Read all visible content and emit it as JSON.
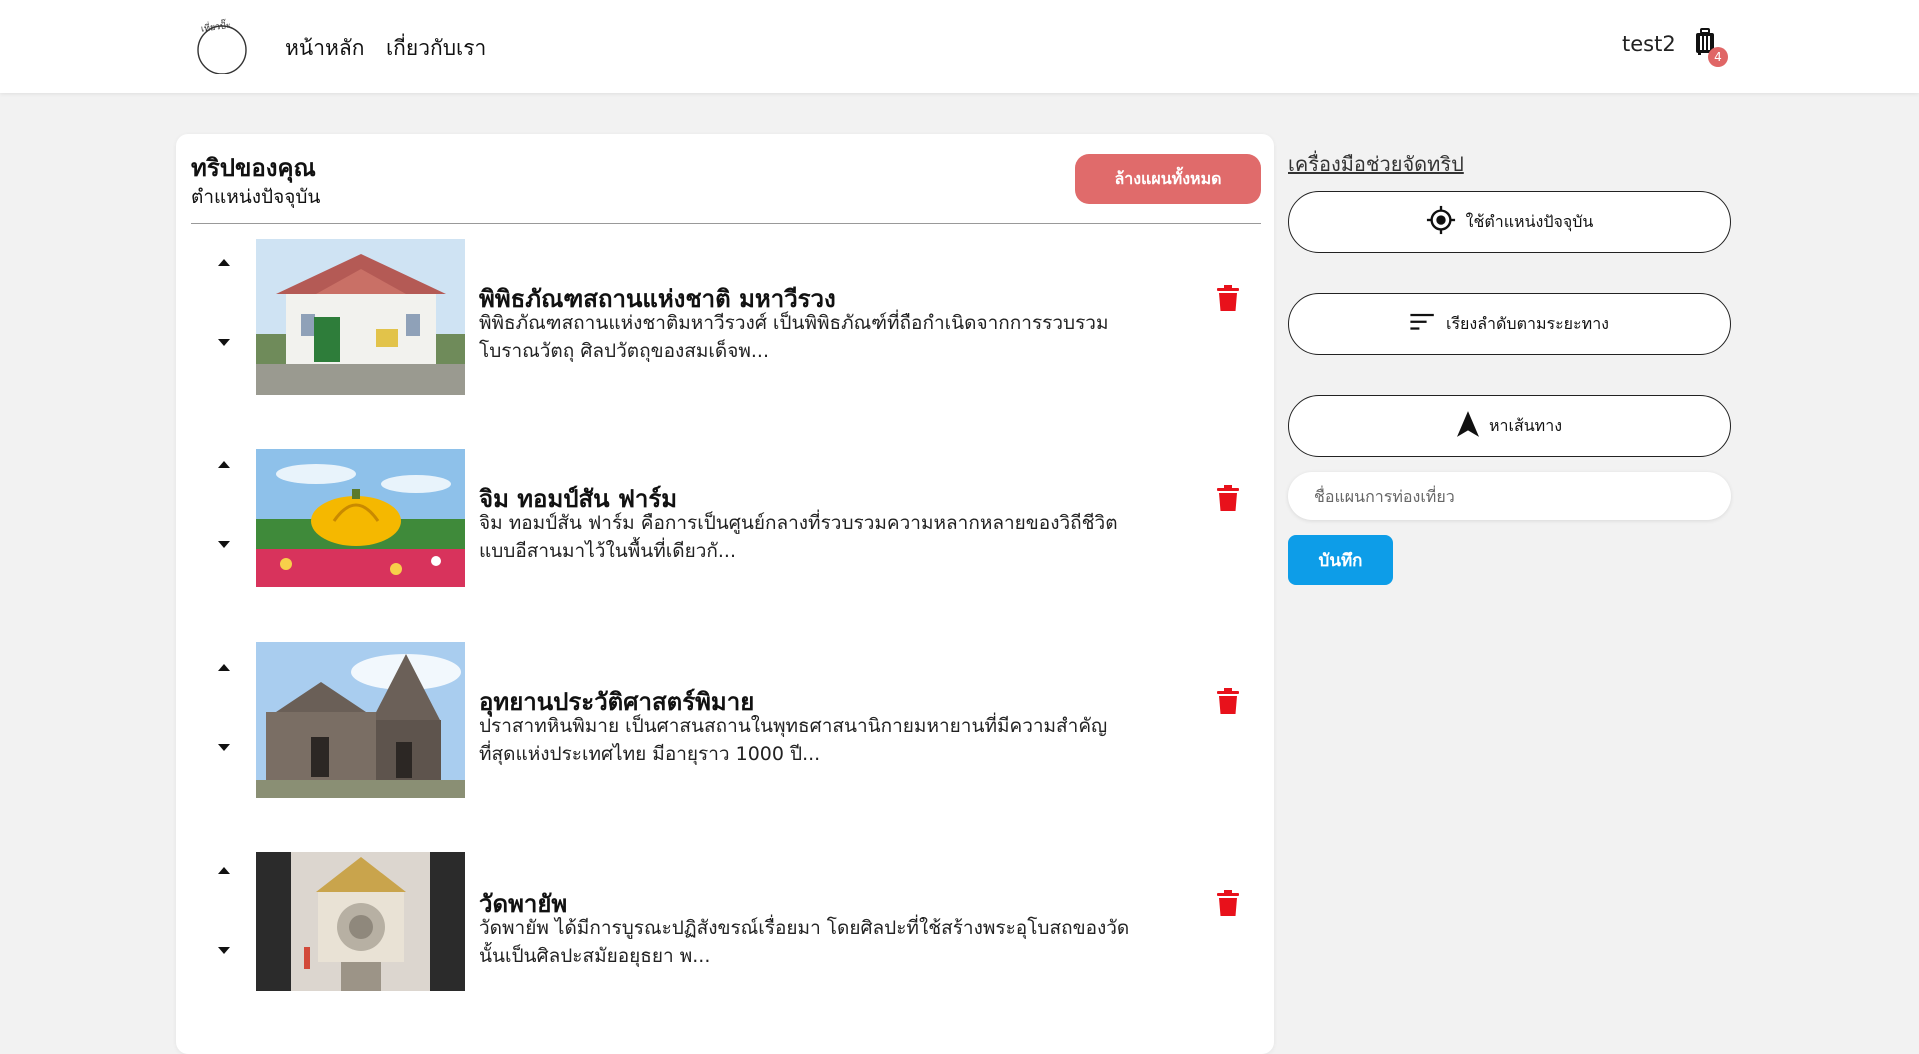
{
  "nav": {
    "logo_text": "เที่ยวปั๊ะ",
    "home_label": "หน้าหลัก",
    "about_label": "เกี่ยวกับเรา",
    "username": "test2",
    "cart_count": "4"
  },
  "trip": {
    "title": "ทริปของคุณ",
    "subtitle": "ตำแหน่งปัจจุบัน",
    "clear_label": "ล้างแผนทั้งหมด",
    "items": [
      {
        "name": "พิพิธภัณฑสถานแห่งชาติ มหาวีรวง",
        "desc": "พิพิธภัณฑสถานแห่งชาติมหาวีรวงศ์ เป็นพิพิธภัณฑ์ที่ถือกำเนิดจากการรวบรวมโบราณวัตถุ ศิลปวัตถุของสมเด็จพ..."
      },
      {
        "name": "จิม ทอมป์สัน ฟาร์ม",
        "desc": "จิม ทอมป์สัน ฟาร์ม คือการเป็นศูนย์กลางที่รวบรวมความหลากหลายของวิถีชีวิตแบบอีสานมาไว้ในพื้นที่เดียวกั..."
      },
      {
        "name": "อุทยานประวัติศาสตร์พิมาย",
        "desc": "ปราสาทหินพิมาย เป็นศาสนสถานในพุทธศาสนานิกายมหายานที่มีความสำคัญที่สุดแห่งประเทศไทย มีอายุราว 1000 ปี..."
      },
      {
        "name": "วัดพายัพ",
        "desc": "วัดพายัพ ได้มีการบูรณะปฏิสังขรณ์เรื่อยมา โดยศิลปะที่ใช้สร้างพระอุโบสถของวัดนั้นเป็นศิลปะสมัยอยุธยา พ..."
      }
    ]
  },
  "tools": {
    "title": "เครื่องมือช่วยจัดทริป",
    "current_location_label": "ใช้ตำแหน่งปัจจุบัน",
    "sort_label": "เรียงลำดับตามระยะทาง",
    "route_label": "หาเส้นทาง",
    "plan_name_placeholder": "ชื่อแผนการท่องเที่ยว",
    "save_label": "บันทึก"
  },
  "colors": {
    "clear_button": "#e06b6b",
    "save_button": "#0d9de8",
    "trash_icon": "#e8111b",
    "badge": "#e06666"
  }
}
